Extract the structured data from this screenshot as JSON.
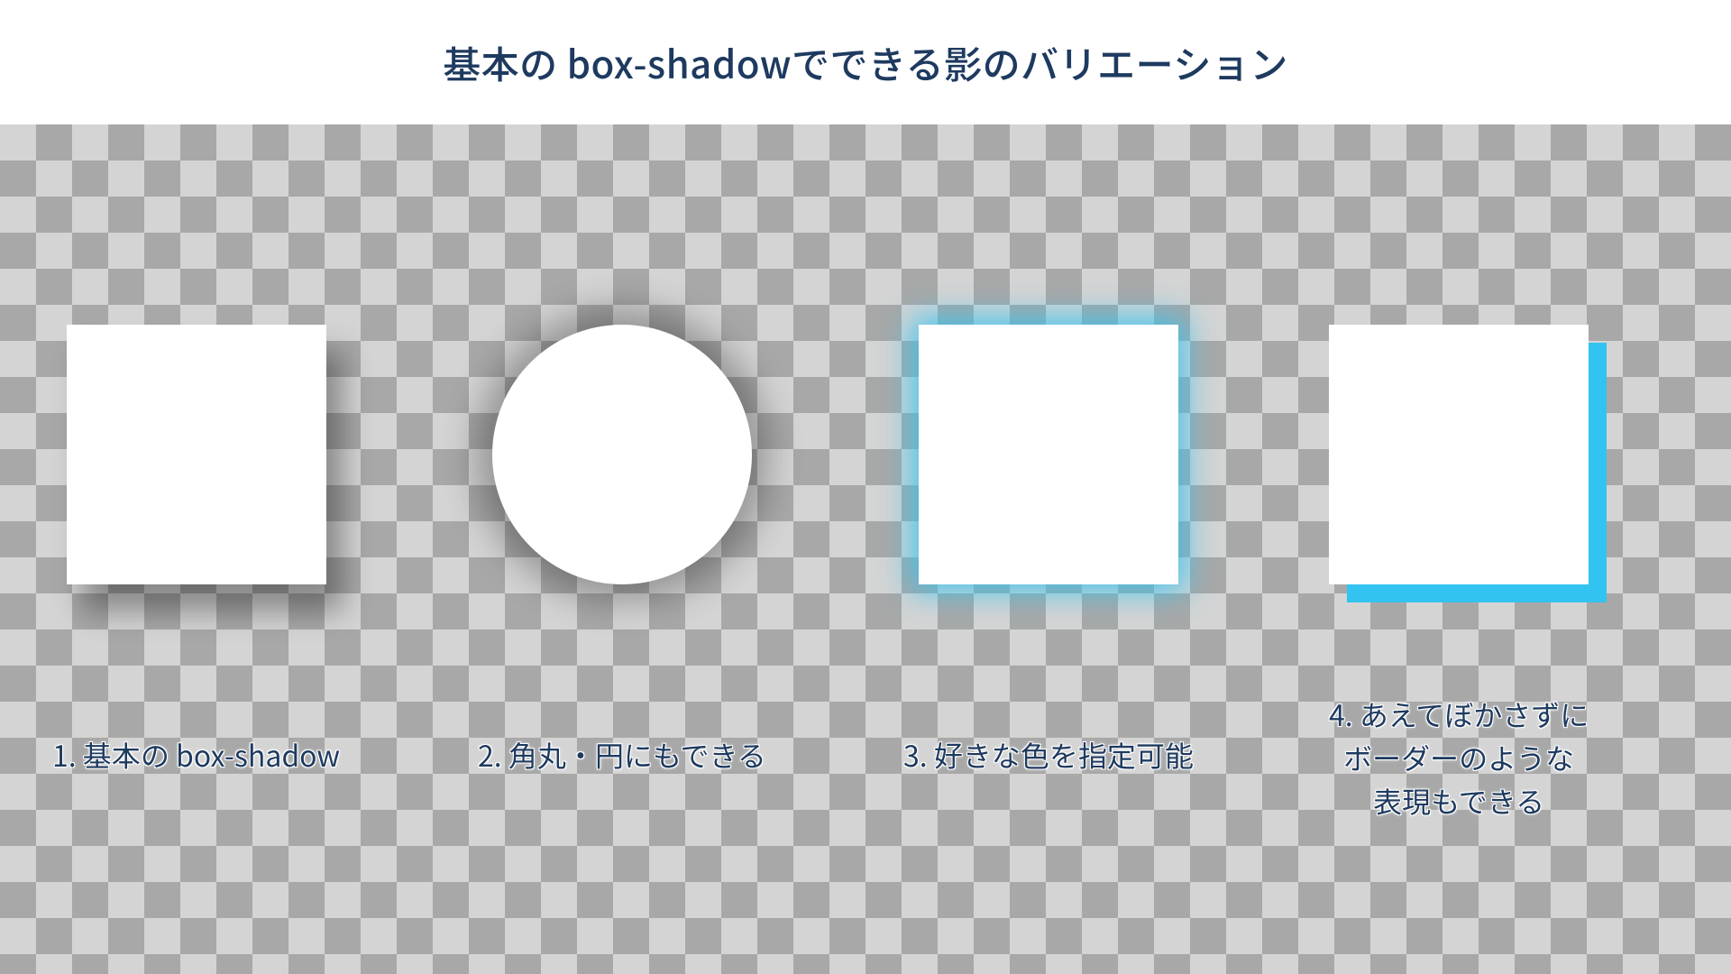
{
  "title": "基本の box-shadowでできる影のバリエーション",
  "examples": [
    {
      "caption": "1. 基本の box-shadow"
    },
    {
      "caption": "2. 角丸・円にもできる"
    },
    {
      "caption": "3. 好きな色を指定可能"
    },
    {
      "caption": "4. あえてぼかさずに\nボーダーのような\n表現もできる"
    }
  ],
  "colors": {
    "title_text": "#1e3a5f",
    "caption_text": "#1e3a5f",
    "accent_cyan": "#33c3f0",
    "checker_dark": "#a8a8a8",
    "checker_light": "#d4d4d4",
    "shape_fill": "#ffffff"
  }
}
